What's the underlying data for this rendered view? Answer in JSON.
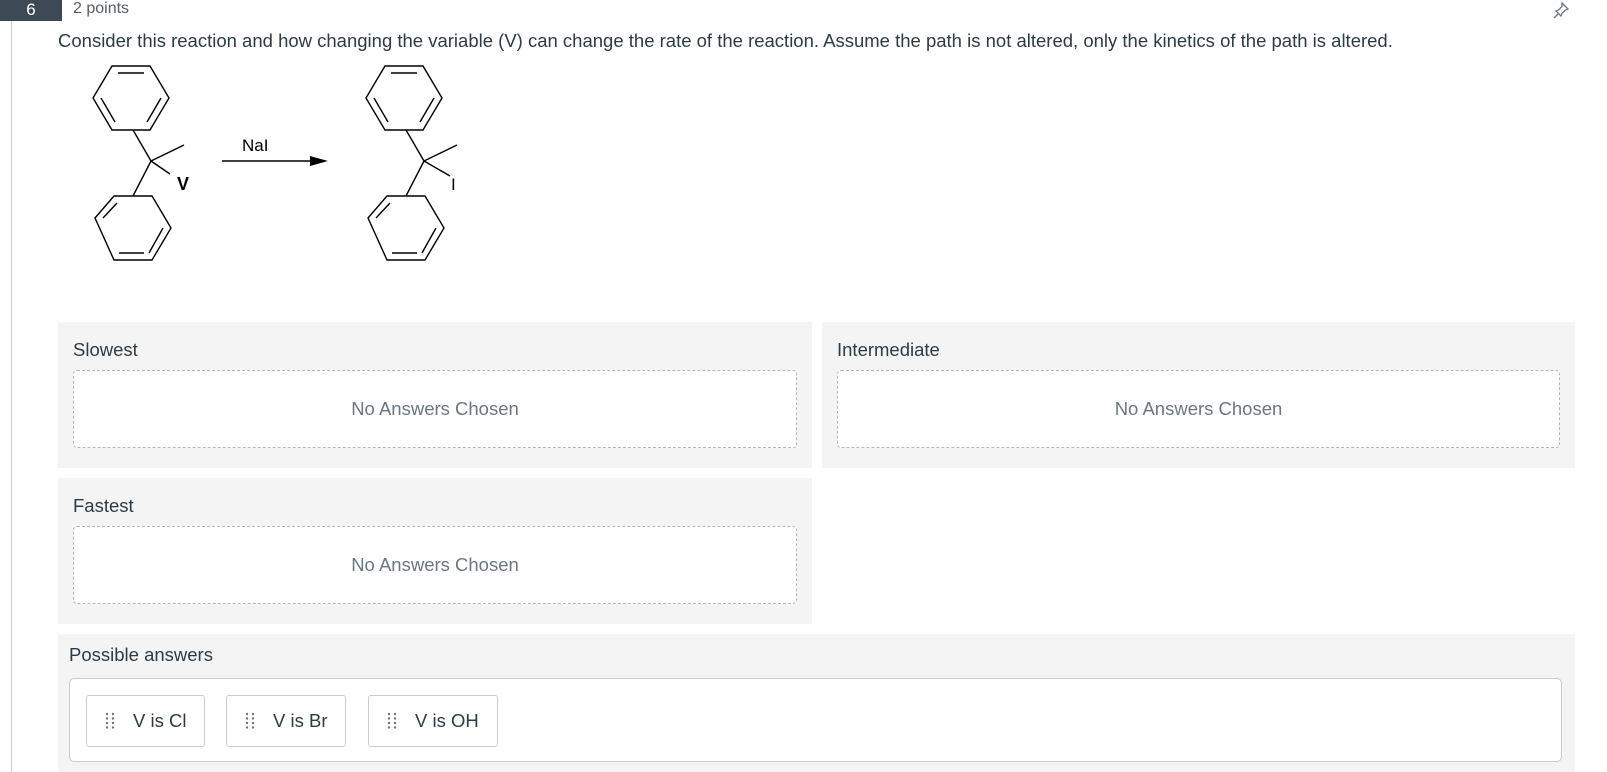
{
  "question": {
    "number": "6",
    "points": "2 points",
    "text": "Consider this reaction and how changing the variable (V) can change the rate of the reaction. Assume the path is not altered, only the kinetics of the path is altered.",
    "reagent": "NaI",
    "reactant_label": "V",
    "product_label": "I"
  },
  "drop_zones": [
    {
      "label": "Slowest",
      "empty_text": "No Answers Chosen"
    },
    {
      "label": "Intermediate",
      "empty_text": "No Answers Chosen"
    },
    {
      "label": "Fastest",
      "empty_text": "No Answers Chosen"
    }
  ],
  "answers": {
    "label": "Possible answers",
    "items": [
      "V is Cl",
      "V is Br",
      "V is OH"
    ]
  },
  "icons": {
    "pin": "pin-icon",
    "grip": "drag-handle-icon"
  },
  "colors": {
    "header_badge": "#3d4a55",
    "zone_bg": "#f4f4f4",
    "text": "#2d3b45"
  }
}
